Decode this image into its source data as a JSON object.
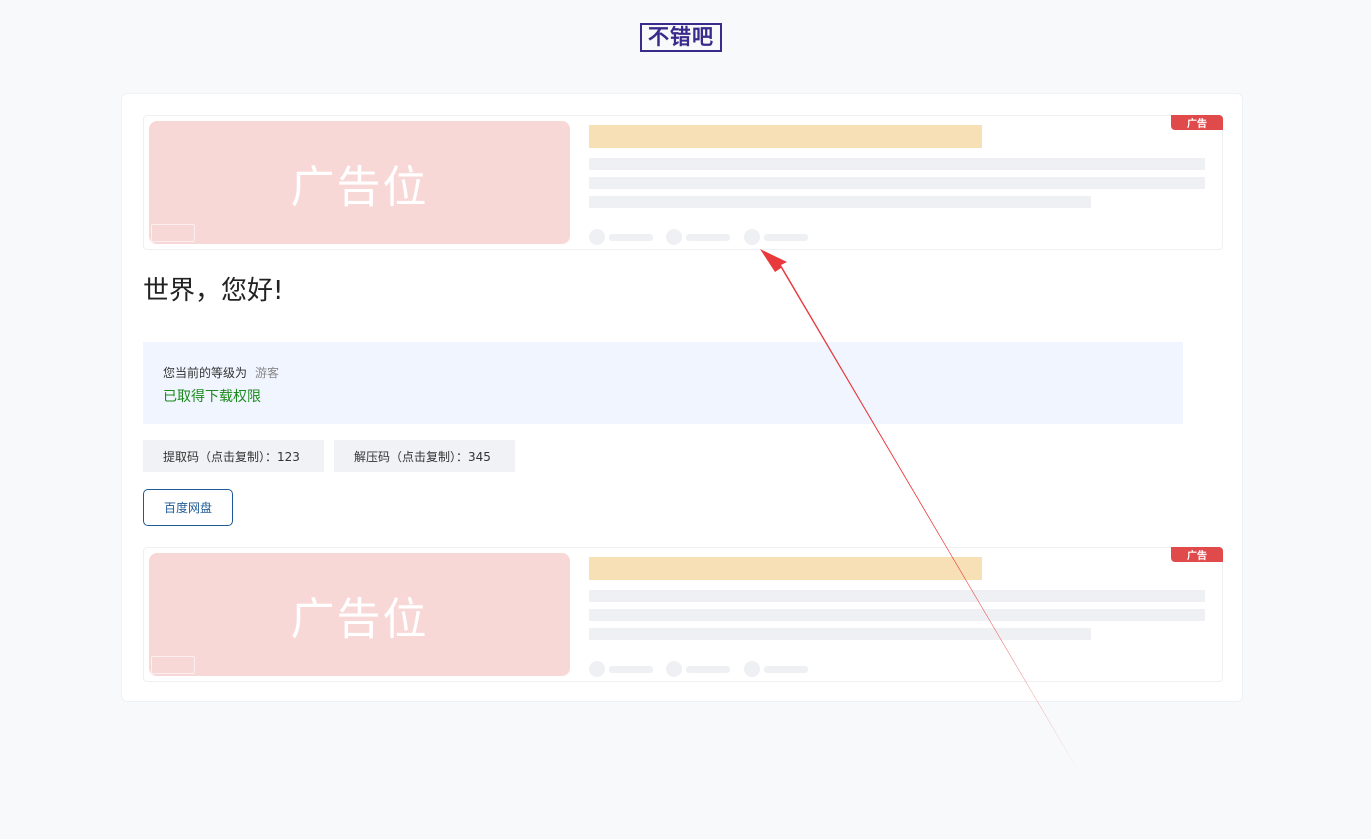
{
  "logo": {
    "text": "不错吧"
  },
  "post": {
    "title": "世界，您好!"
  },
  "ads": [
    {
      "badge": "广告",
      "image_text": "广告位"
    },
    {
      "badge": "广告",
      "image_text": "广告位"
    }
  ],
  "download": {
    "level_label": "您当前的等级为",
    "level_value": "游客",
    "permission_text": "已取得下载权限",
    "extract_code": "提取码（点击复制）：123",
    "unzip_code": "解压码（点击复制）：345",
    "button_label": "百度网盘"
  },
  "colors": {
    "accent": "#1e5a96",
    "logo": "#3a2a8c",
    "ad_badge": "#e04a4a",
    "permission": "#1a8a1a",
    "annotation_arrow": "#e8393c"
  }
}
